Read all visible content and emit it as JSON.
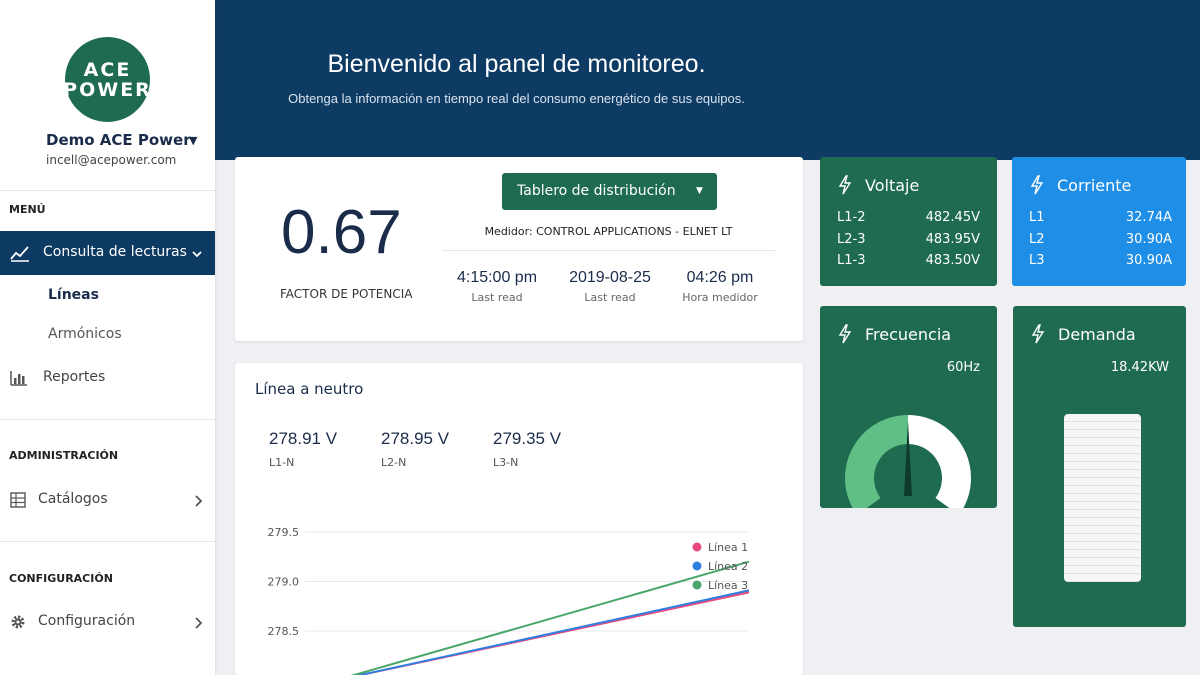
{
  "sidebar": {
    "logo_line1": "ACE",
    "logo_line2": "POWER",
    "user_name": "Demo ACE Power",
    "user_email": "incell@acepower.com",
    "menu_title": "MENÚ",
    "active_item": "Consulta de lecturas",
    "sub_lineas": "Líneas",
    "sub_armonicos": "Armónicos",
    "reportes": "Reportes",
    "admin_title": "ADMINISTRACIÓN",
    "catalogos": "Catálogos",
    "config_title": "CONFIGURACIÓN",
    "configuracion": "Configuración"
  },
  "header": {
    "title": "Bienvenido al panel de monitoreo.",
    "subtitle": "Obtenga la información en tiempo real del consumo energético de sus equipos."
  },
  "summary": {
    "power_factor": "0.67",
    "power_factor_label": "FACTOR DE POTENCIA",
    "dropdown_label": "Tablero de distribución",
    "meter": "Medidor: CONTROL APPLICATIONS - ELNET LT",
    "stats": [
      {
        "value": "4:15:00 pm",
        "label": "Last read"
      },
      {
        "value": "2019-08-25",
        "label": "Last read"
      },
      {
        "value": "04:26 pm",
        "label": "Hora medidor"
      }
    ]
  },
  "chart_card": {
    "title": "Línea a neutro",
    "values": [
      {
        "value": "278.91 V",
        "label": "L1-N"
      },
      {
        "value": "278.95 V",
        "label": "L2-N"
      },
      {
        "value": "279.35 V",
        "label": "L3-N"
      }
    ]
  },
  "chart_data": {
    "type": "line",
    "x": [
      0,
      1
    ],
    "series": [
      {
        "name": "Línea 1",
        "color": "#e8497f",
        "values": [
          278.0,
          278.89
        ]
      },
      {
        "name": "Línea 2",
        "color": "#2f7fe0",
        "values": [
          278.0,
          278.91
        ]
      },
      {
        "name": "Línea 3",
        "color": "#4aa56a",
        "values": [
          278.0,
          279.2
        ]
      }
    ],
    "ylim": [
      278.0,
      279.6
    ],
    "yticks": [
      "279.5",
      "279.0",
      "278.5"
    ],
    "ytick_values": [
      279.5,
      279.0,
      278.5
    ],
    "grid": true,
    "legend": "top-right"
  },
  "tiles": {
    "voltaje": {
      "title": "Voltaje",
      "color": "#1f6b4f",
      "rows": [
        {
          "label": "L1-2",
          "value": "482.45V"
        },
        {
          "label": "L2-3",
          "value": "483.95V"
        },
        {
          "label": "L1-3",
          "value": "483.50V"
        }
      ]
    },
    "corriente": {
      "title": "Corriente",
      "color": "#1e8ee6",
      "rows": [
        {
          "label": "L1",
          "value": "32.74A"
        },
        {
          "label": "L2",
          "value": "30.90A"
        },
        {
          "label": "L3",
          "value": "30.90A"
        }
      ]
    },
    "frecuencia": {
      "title": "Frecuencia",
      "color": "#1f6b4f",
      "value": "60Hz",
      "gauge_fraction": 0.5
    },
    "demanda": {
      "title": "Demanda",
      "color": "#1f6b4f",
      "value": "18.42KW"
    }
  }
}
